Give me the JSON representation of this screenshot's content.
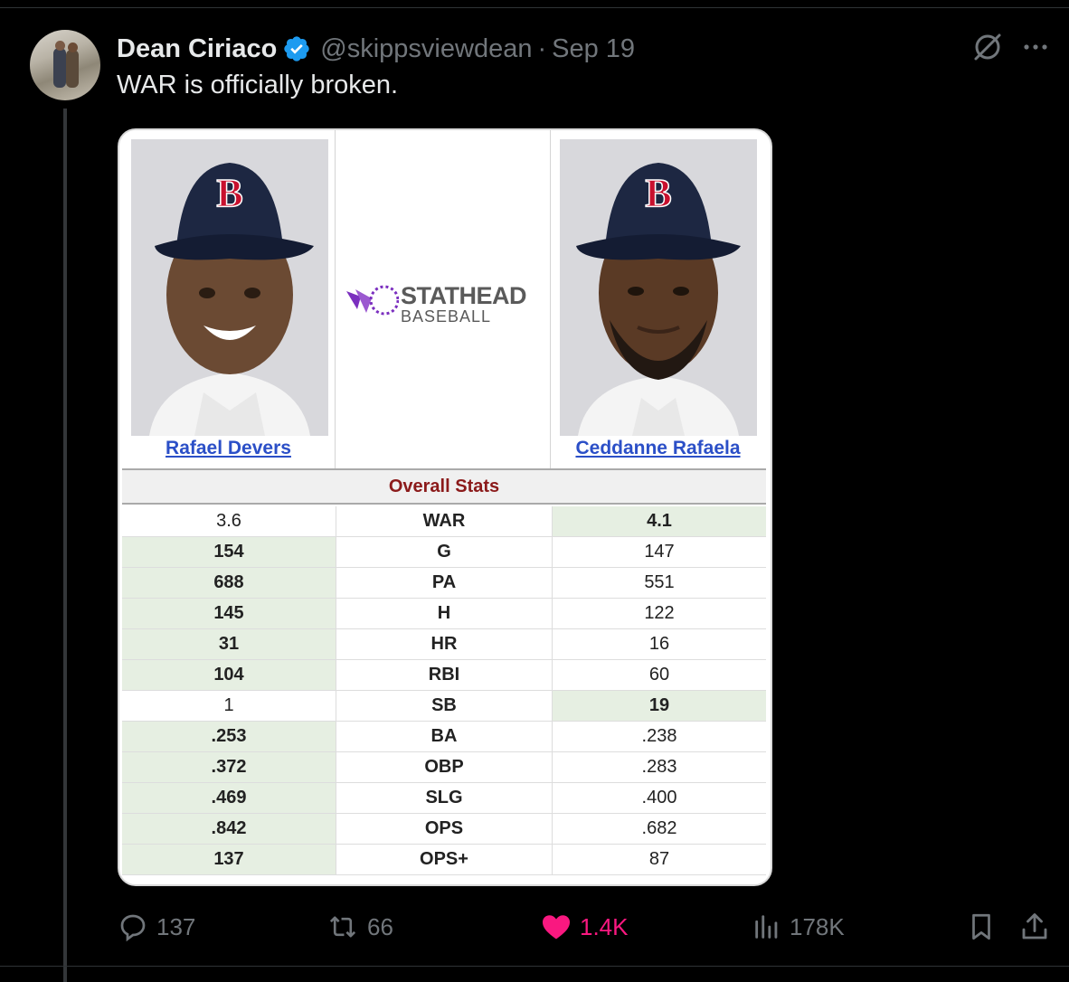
{
  "post": {
    "author_name": "Dean Ciriaco",
    "handle": "@skippsviewdean",
    "separator": "·",
    "date": "Sep 19",
    "text": "WAR is officially broken."
  },
  "media": {
    "left_player": "Rafael Devers",
    "right_player": "Ceddanne Rafaela",
    "logo_brand": "STATHEAD",
    "logo_sub": "BASEBALL",
    "section_title": "Overall Stats",
    "rows": [
      {
        "stat": "WAR",
        "left": "3.6",
        "right": "4.1",
        "winner": "right"
      },
      {
        "stat": "G",
        "left": "154",
        "right": "147",
        "winner": "left"
      },
      {
        "stat": "PA",
        "left": "688",
        "right": "551",
        "winner": "left"
      },
      {
        "stat": "H",
        "left": "145",
        "right": "122",
        "winner": "left"
      },
      {
        "stat": "HR",
        "left": "31",
        "right": "16",
        "winner": "left"
      },
      {
        "stat": "RBI",
        "left": "104",
        "right": "60",
        "winner": "left"
      },
      {
        "stat": "SB",
        "left": "1",
        "right": "19",
        "winner": "right"
      },
      {
        "stat": "BA",
        "left": ".253",
        "right": ".238",
        "winner": "left"
      },
      {
        "stat": "OBP",
        "left": ".372",
        "right": ".283",
        "winner": "left"
      },
      {
        "stat": "SLG",
        "left": ".469",
        "right": ".400",
        "winner": "left"
      },
      {
        "stat": "OPS",
        "left": ".842",
        "right": ".682",
        "winner": "left"
      },
      {
        "stat": "OPS+",
        "left": "137",
        "right": "87",
        "winner": "left"
      }
    ]
  },
  "actions": {
    "replies": "137",
    "reposts": "66",
    "likes": "1.4K",
    "views": "178K"
  },
  "colors": {
    "background": "#000000",
    "like_pink": "#f91880",
    "verified_blue": "#1d9bf0",
    "muted": "#71767b",
    "winner_cell": "#e6efe2",
    "section_title": "#8b1a1a",
    "player_link": "#2b4fc7",
    "logo_purple": "#7b2fbf"
  }
}
